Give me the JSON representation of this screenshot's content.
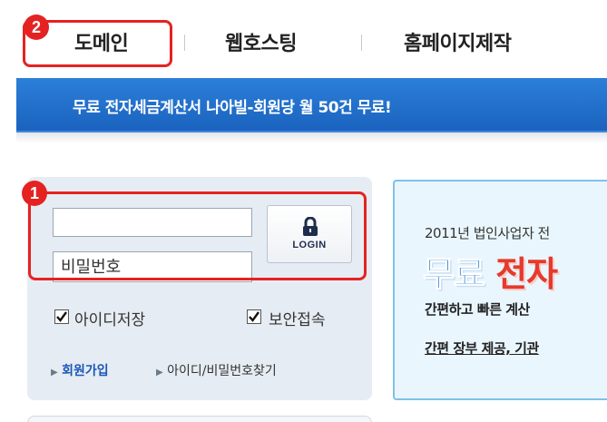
{
  "nav": {
    "items": [
      {
        "label": "도메인"
      },
      {
        "label": "웹호스팅"
      },
      {
        "label": "홈페이지제작"
      }
    ]
  },
  "banner": {
    "text": "무료 전자세금계산서 나아빌-회원당 월 50건 무료!",
    "color": "#1f6fcf"
  },
  "markers": {
    "one": "1",
    "two": "2",
    "color": "#e52222"
  },
  "login": {
    "id_placeholder": "",
    "password_placeholder": "비밀번호",
    "button_label": "LOGIN",
    "save_id_label": "아이디저장",
    "secure_login_label": "보안접속",
    "save_id_checked": true,
    "secure_login_checked": true,
    "signup_link": "회원가입",
    "find_link": "아이디/비밀번호찾기",
    "lock_icon": "lock-icon"
  },
  "promo": {
    "year_line": "2011년 법인사업자 전",
    "big_part_1": "무료",
    "big_part_2": "전자",
    "line1": "간편하고 빠른 계산",
    "line2": "간편 장부 제공, 기관"
  }
}
